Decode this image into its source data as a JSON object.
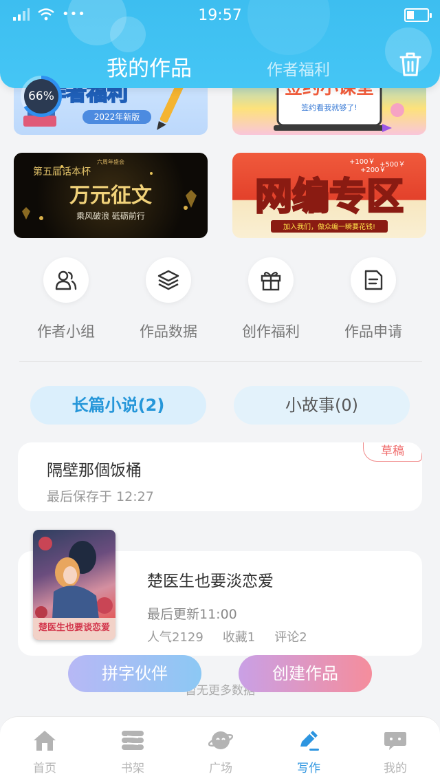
{
  "status_bar": {
    "time": "19:57",
    "dots": "•••"
  },
  "header": {
    "tabs": [
      {
        "label": "我的作品",
        "active": true
      },
      {
        "label": "作者福利",
        "active": false
      }
    ],
    "trash_icon": "trash-icon"
  },
  "progress_ring": {
    "label": "66%",
    "value": 0.66
  },
  "banners": [
    {
      "name": "author-welfare-banner",
      "title": "作者福利",
      "subtitle": "2022年新版"
    },
    {
      "name": "sign-class-banner",
      "title": "签约小课堂",
      "subtitle": "签约看我就够了!"
    },
    {
      "name": "essay-contest-banner",
      "kicker": "第五届话本杯",
      "top": "六周年盛会",
      "title": "万元征文",
      "subtitle": "乘风破浪 砥砺前行"
    },
    {
      "name": "web-editor-banner",
      "title": "网编专区",
      "subtitle": "加入我们，做众编一瞬要花钱!",
      "prices": [
        "+100￥",
        "+500￥",
        "+200￥"
      ]
    }
  ],
  "quick_actions": [
    {
      "label": "作者小组",
      "icon": "users-icon"
    },
    {
      "label": "作品数据",
      "icon": "layers-icon"
    },
    {
      "label": "创作福利",
      "icon": "gift-icon"
    },
    {
      "label": "作品申请",
      "icon": "document-icon"
    }
  ],
  "category_tabs": [
    {
      "label": "长篇小说(2)",
      "active": true
    },
    {
      "label": "小故事(0)",
      "active": false
    }
  ],
  "draft": {
    "title": "隔壁那個饭桶",
    "saved": "最后保存于 12:27",
    "badge": "草稿"
  },
  "work": {
    "title": "楚医生也要淡恋爱",
    "updated": "最后更新11:00",
    "popularity": "人气2129",
    "favorites": "收藏1",
    "comments": "评论2",
    "cover_text": "楚医生也要谈恋爱"
  },
  "no_more_text": "暂无更多数据",
  "fab": {
    "left": "拼字伙伴",
    "right": "创建作品"
  },
  "bottom_nav": [
    {
      "label": "首页",
      "icon": "home-icon",
      "active": false
    },
    {
      "label": "书架",
      "icon": "bookshelf-icon",
      "active": false
    },
    {
      "label": "广场",
      "icon": "planet-icon",
      "active": false
    },
    {
      "label": "写作",
      "icon": "pen-icon",
      "active": true
    },
    {
      "label": "我的",
      "icon": "chat-bubble-icon",
      "active": false
    }
  ],
  "colors": {
    "accent": "#2d95e0",
    "header": "#3dbef0",
    "badge": "#ef6b6b"
  }
}
